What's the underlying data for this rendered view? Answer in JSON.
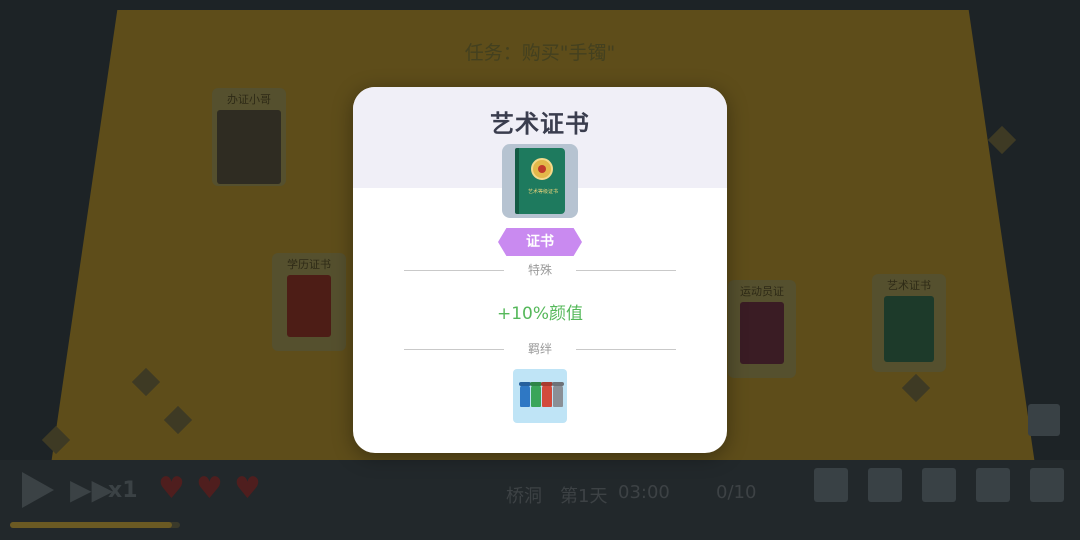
{
  "scene": {
    "task_text": "任务：购买\"手镯\"",
    "shelf_items": [
      {
        "label": "办证小哥"
      },
      {
        "label": "学历证书"
      },
      {
        "label": "运动员证"
      },
      {
        "label": "艺术证书"
      }
    ]
  },
  "hud": {
    "speed": "x1",
    "hearts": 3,
    "location": "桥洞",
    "day": "第1天",
    "time": "03:00",
    "inventory": "0/10",
    "icons": [
      "play-icon",
      "fast-forward-icon",
      "heart-icon",
      "computer-icon",
      "layers-icon",
      "map-icon",
      "book-icon",
      "exit-icon",
      "clipboard-icon"
    ]
  },
  "modal": {
    "title": "艺术证书",
    "item_icon": "green-certificate-book-icon",
    "book_text": "艺术等级证书",
    "tag": "证书",
    "special_label": "特殊",
    "effect": "+10%颜值",
    "bond_label": "羁绊",
    "bond_icon": "trash-bins-icon"
  },
  "colors": {
    "modal_header": "#f0eff7",
    "tag": "#c98af0",
    "effect": "#55b85a",
    "book": "#1e7a5e"
  }
}
